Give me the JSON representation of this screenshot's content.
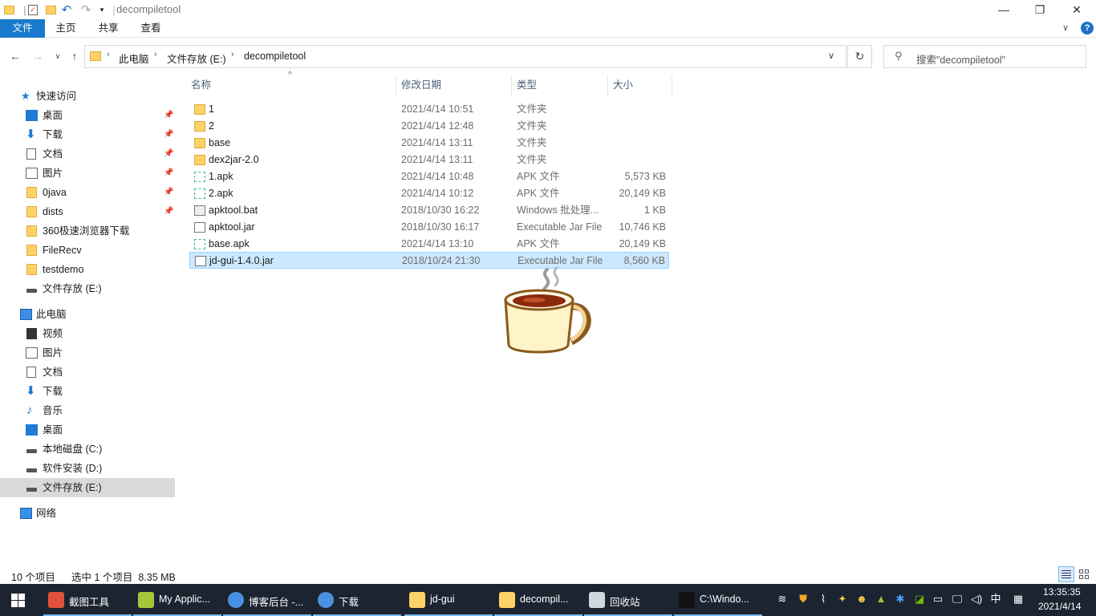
{
  "window": {
    "title": "decompiletool",
    "minimize": "—",
    "restore": "❐",
    "close": "✕"
  },
  "ribbon": {
    "tabs": [
      "文件",
      "主页",
      "共享",
      "查看"
    ],
    "help": "?",
    "collapse": "∨"
  },
  "address": {
    "segments": [
      "此电脑",
      "文件存放 (E:)",
      "decompiletool"
    ],
    "separator": "›",
    "dropdown": "∨",
    "refresh": "↻"
  },
  "search": {
    "placeholder": "搜索\"decompiletool\""
  },
  "sidebar": {
    "quick_access": "快速访问",
    "quick_items": [
      {
        "label": "桌面",
        "pinned": true
      },
      {
        "label": "下载",
        "pinned": true
      },
      {
        "label": "文档",
        "pinned": true
      },
      {
        "label": "图片",
        "pinned": true
      },
      {
        "label": "0java",
        "pinned": true
      },
      {
        "label": "dists",
        "pinned": true
      },
      {
        "label": "360极速浏览器下载",
        "pinned": false
      },
      {
        "label": "FileRecv",
        "pinned": false
      },
      {
        "label": "testdemo",
        "pinned": false
      },
      {
        "label": "文件存放 (E:)",
        "pinned": false
      }
    ],
    "this_pc": "此电脑",
    "pc_items": [
      "视频",
      "图片",
      "文档",
      "下载",
      "音乐",
      "桌面",
      "本地磁盘 (C:)",
      "软件安装 (D:)",
      "文件存放 (E:)"
    ],
    "network": "网络",
    "pin_glyph": "📌"
  },
  "columns": [
    "名称",
    "修改日期",
    "类型",
    "大小"
  ],
  "files": [
    {
      "name": "1",
      "date": "2021/4/14 10:51",
      "type": "文件夹",
      "size": "",
      "kind": "folder"
    },
    {
      "name": "2",
      "date": "2021/4/14 12:48",
      "type": "文件夹",
      "size": "",
      "kind": "folder"
    },
    {
      "name": "base",
      "date": "2021/4/14 13:11",
      "type": "文件夹",
      "size": "",
      "kind": "folder"
    },
    {
      "name": "dex2jar-2.0",
      "date": "2021/4/14 13:11",
      "type": "文件夹",
      "size": "",
      "kind": "folder"
    },
    {
      "name": "1.apk",
      "date": "2021/4/14 10:48",
      "type": "APK 文件",
      "size": "5,573 KB",
      "kind": "apk"
    },
    {
      "name": "2.apk",
      "date": "2021/4/14 10:12",
      "type": "APK 文件",
      "size": "20,149 KB",
      "kind": "apk"
    },
    {
      "name": "apktool.bat",
      "date": "2018/10/30 16:22",
      "type": "Windows 批处理...",
      "size": "1 KB",
      "kind": "bat"
    },
    {
      "name": "apktool.jar",
      "date": "2018/10/30 16:17",
      "type": "Executable Jar File",
      "size": "10,746 KB",
      "kind": "jar"
    },
    {
      "name": "base.apk",
      "date": "2021/4/14 13:10",
      "type": "APK 文件",
      "size": "20,149 KB",
      "kind": "apk"
    },
    {
      "name": "jd-gui-1.4.0.jar",
      "date": "2018/10/24 21:30",
      "type": "Executable Jar File",
      "size": "8,560 KB",
      "kind": "jar",
      "selected": true
    }
  ],
  "status": {
    "count": "10 个项目",
    "selection": "选中 1 个项目  8.35 MB"
  },
  "taskbar": {
    "items": [
      {
        "label": "截图工具",
        "color": "#e0503c"
      },
      {
        "label": "My Applic...",
        "color": "#a4c639"
      },
      {
        "label": "博客后台 -...",
        "color": "#4a90e2"
      },
      {
        "label": "下载",
        "color": "#4a90e2"
      },
      {
        "label": "jd-gui",
        "color": "#ffd266"
      },
      {
        "label": "decompil...",
        "color": "#ffd266"
      },
      {
        "label": "回收站",
        "color": "#cfd8e0"
      },
      {
        "label": "C:\\Windo...",
        "color": "#111111"
      }
    ],
    "ime": "中",
    "time": "13:35:35",
    "date": "2021/4/14"
  }
}
